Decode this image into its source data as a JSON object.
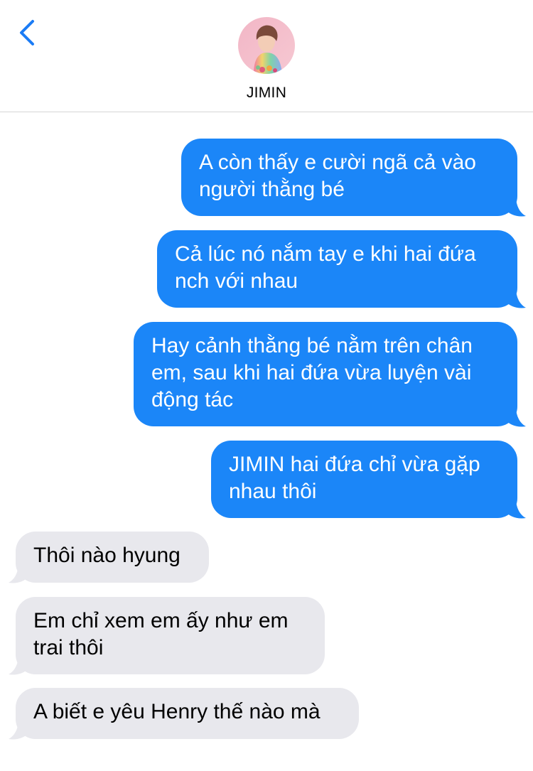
{
  "header": {
    "contact_name": "JIMIN",
    "back_icon": "chevron-left-icon"
  },
  "colors": {
    "sent_bubble": "#1b86f8",
    "received_bubble": "#e8e8ed",
    "accent": "#1b7cf5"
  },
  "messages": [
    {
      "direction": "sent",
      "text": "A còn thấy e cười ngã cả vào người thằng bé"
    },
    {
      "direction": "sent",
      "text": "Cả lúc nó nắm tay e khi hai đứa nch với nhau"
    },
    {
      "direction": "sent",
      "text": "Hay cảnh thằng bé nằm trên chân em, sau khi hai đứa vừa luyện vài động tác"
    },
    {
      "direction": "sent",
      "text": "JIMIN hai đứa chỉ vừa gặp nhau thôi"
    },
    {
      "direction": "received",
      "text": "Thôi nào hyung"
    },
    {
      "direction": "received",
      "text": "Em chỉ xem em ấy như em trai thôi"
    },
    {
      "direction": "received",
      "text": "A biết e yêu Henry thế nào mà"
    }
  ]
}
